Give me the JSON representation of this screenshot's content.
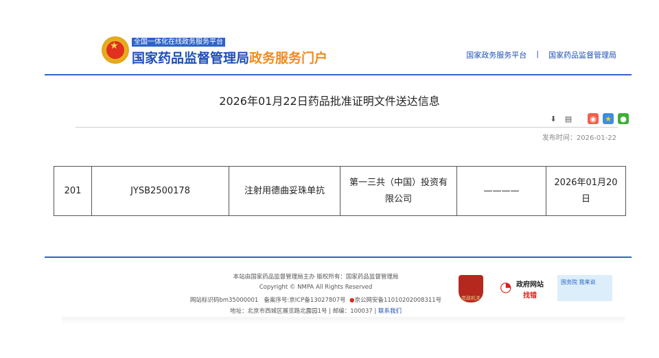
{
  "header": {
    "tagline": "全国一体化在线政务服务平台",
    "logo_main": "国家药品监督管理局",
    "logo_accent": "政务服务门户",
    "links": [
      "国家政务服务平台",
      "|",
      "国家药品监督管理局"
    ]
  },
  "article": {
    "title": "2026年01月22日药品批准证明文件送达信息",
    "publish_label": "发布时间：",
    "publish_date": "2026-01-22"
  },
  "table": {
    "rows": [
      [
        "201",
        "JYSB2500178",
        "注射用德曲妥珠单抗",
        "第一三共（中国）投资有限公司",
        "————",
        "2026年01月20日"
      ]
    ]
  },
  "footer": {
    "line1": "本站由国家药品监督管理局主办 版权所有：国家药品监督管理局",
    "line2": "Copyright © NMPA All Rights Reserved",
    "site_id": "网站标识码bm35000001",
    "icp": "备案序号:京ICP备13027807号",
    "police": "京公网安备11010202008311号",
    "address": "地址：北京市西城区展览路北露园1号 | 邮编：100037 |",
    "contact": "联系我们",
    "badge1": "党政机关",
    "badge2_top": "政府网站",
    "badge2_bottom": "找错",
    "badge3": "国务院 我来说"
  },
  "colors": {
    "blue": "#2d64c8",
    "orange": "#f08a1c"
  }
}
